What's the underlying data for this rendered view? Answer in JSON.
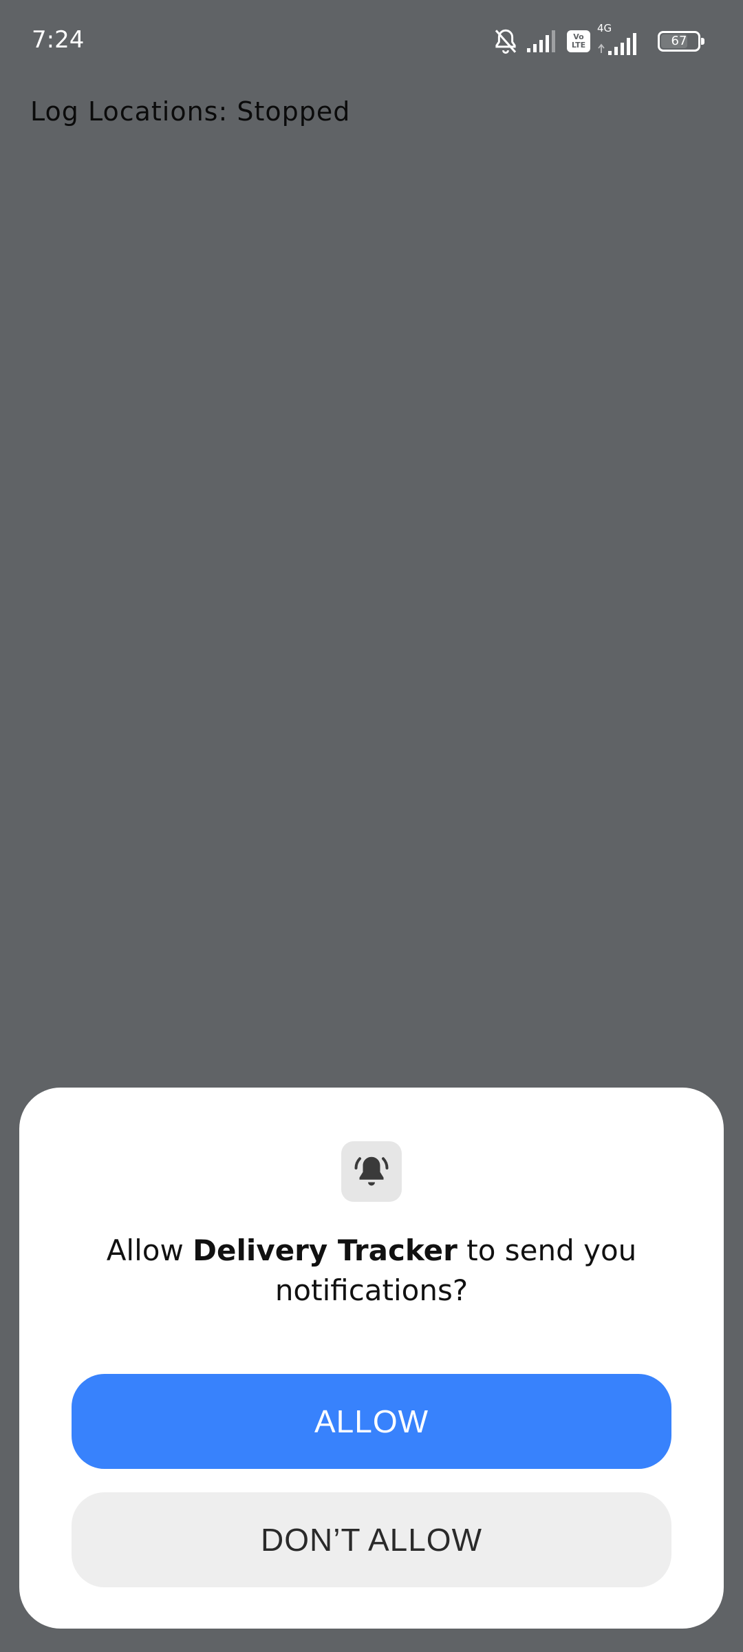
{
  "status_bar": {
    "time": "7:24",
    "network_type": "4G",
    "volte_top": "Vo",
    "volte_bottom": "LTE",
    "battery": "67",
    "icons": [
      "bell-off-icon",
      "signal-icon",
      "volte-icon",
      "signal-icon",
      "battery-icon"
    ]
  },
  "main": {
    "log_status": "Log Locations: Stopped"
  },
  "dialog": {
    "icon": "bell-ringing-icon",
    "message_prefix": "Allow ",
    "app_name": "Delivery Tracker",
    "message_suffix": " to send you notifications?",
    "allow_label": "ALLOW",
    "deny_label": "DON’T ALLOW"
  },
  "colors": {
    "background": "#606366",
    "dialog_background": "#ffffff",
    "allow_button": "#3882fc",
    "deny_button": "#eeeeee"
  }
}
